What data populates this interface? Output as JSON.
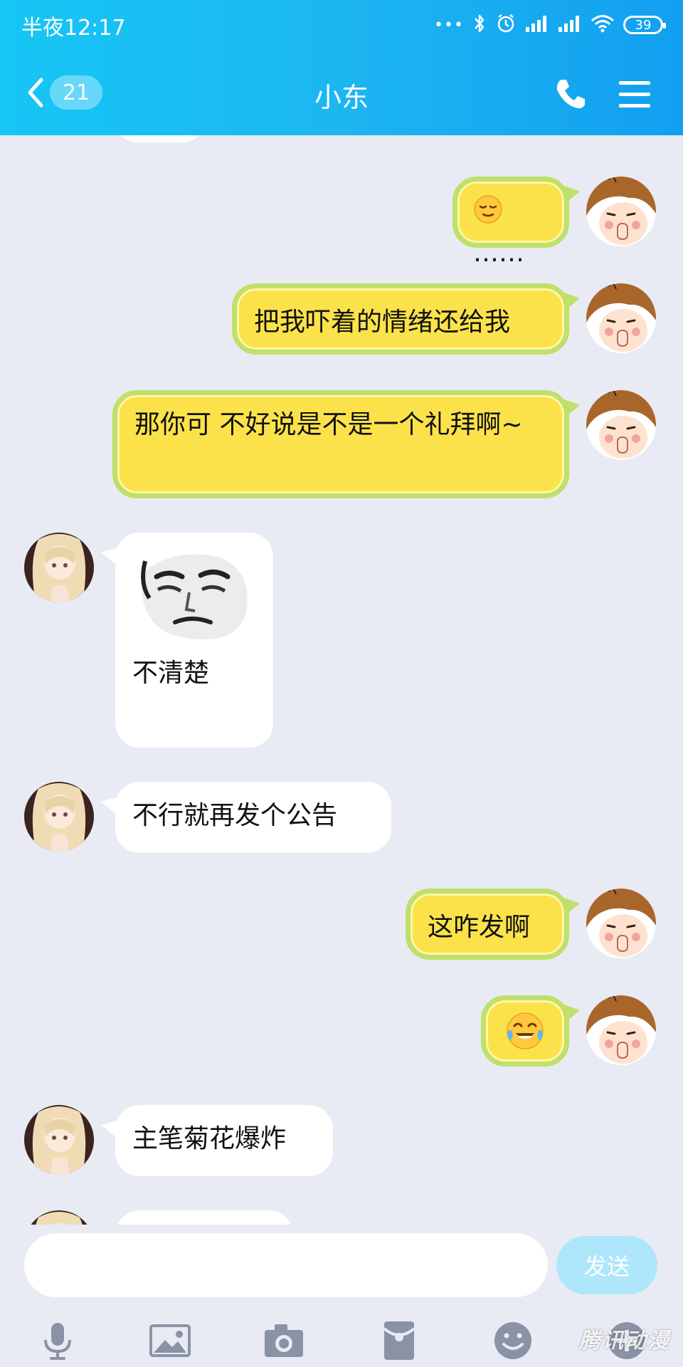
{
  "status_bar": {
    "time": "半夜12:17",
    "dots": "•••",
    "battery": "39"
  },
  "header": {
    "back_count": "21",
    "title": "小东",
    "phone_icon": "phone-icon",
    "menu_icon": "menu-icon"
  },
  "messages": [
    {
      "sender": "self",
      "text": "……",
      "emoji": "relieved-face"
    },
    {
      "sender": "self",
      "text": "把我吓着的情绪还给我"
    },
    {
      "sender": "self",
      "text": "那你可 不好说是不是一个礼拜啊~"
    },
    {
      "sender": "other",
      "text": "不清楚",
      "sticker": "meme-face-sticker"
    },
    {
      "sender": "other",
      "text": "不行就再发个公告"
    },
    {
      "sender": "self",
      "text": "这咋发啊"
    },
    {
      "sender": "self",
      "emoji": "tears-of-joy-face"
    },
    {
      "sender": "other",
      "text": "主笔菊花爆炸"
    }
  ],
  "composer": {
    "input_value": "",
    "send_label": "发送"
  },
  "toolbar": [
    "mic-icon",
    "image-icon",
    "camera-icon",
    "red-packet-icon",
    "emoji-icon",
    "plus-icon"
  ],
  "watermark": "腾讯动漫",
  "colors": {
    "header_start": "#16c6f5",
    "header_end": "#129ff0",
    "self_bubble": "#fbe24a",
    "self_bubble_border": "#bfe06a",
    "background": "#e8ebf3",
    "send_button": "#aee6fb"
  }
}
